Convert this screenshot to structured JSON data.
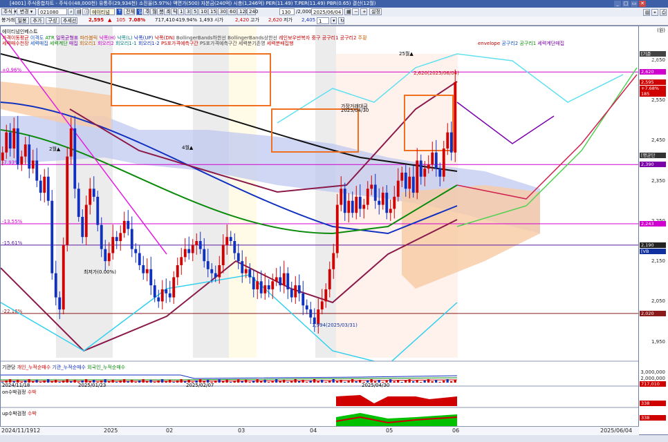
{
  "window": {
    "title": "[4001] 주식종합차트 - 주식수(48,000천) 유통주(29,934천) 소진율(5.97%) 액면가(500) 자본금(240억) 시총(1,246억) PER(11.49) T.PER(11.49) PBR(0.65) 결산(12월)"
  },
  "toolbar": {
    "type_sel": "주식 ▾",
    "change_btn": "변경 ▾",
    "code": "021080",
    "stock_name": "에이티넘",
    "period_label": "T",
    "all_btn": "전체",
    "timeframes": [
      "일",
      "주",
      "월",
      "분",
      "초",
      "틱",
      "1",
      "3",
      "5",
      "10",
      "15",
      "30",
      "60",
      "120",
      "240"
    ],
    "period_arrow": "▾"
  },
  "quote": {
    "company": "에이티넘인베스트",
    "left_tab1": "봉거래",
    "left_tab2": "일봉",
    "tab_add": "추가",
    "tab_comp": "구성",
    "tab_addval": "추세선",
    "price": "2,595",
    "change_arrow": "▲",
    "change": "105",
    "change_pct": "7.08%",
    "volume": "717,410",
    "ratio": "419.94%",
    "ratio_cap": "1,493",
    "open_label": "시가",
    "open": "2,420",
    "high_label": "고가",
    "high": "2,620",
    "low_label": "저가",
    "low": "2,405",
    "count": "130",
    "total": "/2,000",
    "date": "2025/06/04",
    "settings_btn": "설정",
    "page": "1"
  },
  "legend": {
    "row1": [
      "가격이동평균",
      "이격도",
      "ATR",
      "일목균형표",
      "파라볼릭",
      "낙폭(H)",
      "낙폭(L)",
      "낙폭(UP)",
      "낙폭(DN)",
      "BollingerBands하한선",
      "BollingerBands상한선",
      "레인보우반복자",
      "중구",
      "공구리1",
      "공구리2",
      "주황"
    ],
    "row2": [
      "세력매수천장",
      "세력매집",
      "세력계단",
      "매집",
      "회오리1",
      "회오리2",
      "회오리1-1",
      "회오리1-2",
      "PS포가격예측구간",
      "PS포가격예측구간",
      "세력분기존명",
      "세력분배집행"
    ],
    "row3": [
      "envelope",
      "공구리2",
      "공구리1",
      "세력계단매집"
    ]
  },
  "chart_data": {
    "type": "candlestick",
    "title": "에이티넘인베스트 일봉",
    "ylim": [
      1910,
      2720
    ],
    "yticks": [
      2650,
      2550,
      2450,
      2350,
      2250,
      2150,
      2050,
      1950
    ],
    "xlabels": [
      "2024/11/19",
      "12",
      "2025",
      "02",
      "03",
      "04",
      "05",
      "06",
      "2025/06/04"
    ],
    "flags": [
      {
        "label": "[기준선]2,665",
        "value": 2665,
        "color": "#444"
      },
      {
        "label": "2,620",
        "value": 2620,
        "color": "#d000d0"
      },
      {
        "label": "2,595",
        "value": 2595,
        "color": "#d00000"
      },
      {
        "label": "+7.68%",
        "value": 2580,
        "color": "#d00000"
      },
      {
        "label": "185",
        "value": 2565,
        "color": "#d00000"
      },
      {
        "label": "[평균단가]2,412",
        "value": 2412,
        "color": "#333"
      },
      {
        "label": "2,390",
        "value": 2390,
        "color": "#7a00aa"
      },
      {
        "label": "2,243",
        "value": 2243,
        "color": "#d000d0"
      },
      {
        "label": "2,190",
        "value": 2190,
        "color": "#222"
      },
      {
        "label": "[VB선]2,175",
        "value": 2175,
        "color": "#1030a0"
      },
      {
        "label": "2,020",
        "value": 2020,
        "color": "#8a1a1a"
      }
    ],
    "hlines": [
      {
        "label": "+0.96%",
        "value": 2620,
        "color": "#d000d0"
      },
      {
        "label": "-7.93%",
        "value": 2390,
        "color": "#d000d0"
      },
      {
        "label": "-13.55%",
        "value": 2243,
        "color": "#d000d0"
      },
      {
        "label": "-15.61%",
        "value": 2190,
        "color": "#5a1aa0"
      },
      {
        "label": "-22.16%",
        "value": 2020,
        "color": "#8a1a1a"
      }
    ],
    "annotations": [
      {
        "text": "최저가(0.00%)",
        "color": "#000"
      },
      {
        "text": "2월▲",
        "color": "#000"
      },
      {
        "text": "4월▲",
        "color": "#000"
      },
      {
        "text": "25월▲",
        "color": "#000"
      },
      {
        "text": "2,620(2025/06/04)",
        "color": "#d00000"
      },
      {
        "text": "1,994(2025/03/31)",
        "color": "#1030a0"
      },
      {
        "text": "가장거래대금",
        "color": "#000"
      },
      {
        "text": "2025/04/30",
        "color": "#000"
      }
    ],
    "closes": [
      2420,
      2470,
      2430,
      2480,
      2390,
      2410,
      2440,
      2380,
      2400,
      2350,
      2320,
      2360,
      2300,
      2120,
      2060,
      2030,
      2190,
      2410,
      2480,
      2330,
      2260,
      2210,
      2290,
      2330,
      2310,
      2240,
      2180,
      2150,
      2170,
      2210,
      2200,
      2220,
      2250,
      2230,
      2180,
      2170,
      2140,
      2120,
      2130,
      2090,
      2060,
      2050,
      2080,
      2070,
      2060,
      2110,
      2140,
      2160,
      2180,
      2170,
      2190,
      2200,
      2180,
      2150,
      2130,
      2120,
      2110,
      2140,
      2190,
      2210,
      2200,
      2170,
      2150,
      2120,
      2130,
      2110,
      2080,
      2100,
      2070,
      2090,
      2080,
      2100,
      2110,
      2090,
      2120,
      2080,
      2060,
      2090,
      2070,
      2040,
      2030,
      2010,
      1994,
      2030,
      2050,
      2080,
      2130,
      2170,
      2290,
      2330,
      2270,
      2300,
      2270,
      2310,
      2280,
      2290,
      2330,
      2340,
      2300,
      2290,
      2320,
      2270,
      2280,
      2310,
      2350,
      2370,
      2330,
      2360,
      2320,
      2400,
      2360,
      2380,
      2390,
      2420,
      2380,
      2360,
      2430,
      2470,
      2420,
      2595
    ]
  },
  "subpanels": {
    "p1": {
      "labels": [
        "기관당",
        "개인_누적순매수",
        "기관_누적순매수",
        "외국인_누적순매수"
      ],
      "date_l": "2024/11/18",
      "date_m": "2025/01/23",
      "date_r": "2025/02/07",
      "date_r2": "2025/04/30",
      "ticks": [
        "3,000,000",
        "2,000,000"
      ],
      "value": "717,010"
    },
    "p2": {
      "labels": [
        "on수박검정",
        "수박"
      ],
      "tick": "338"
    },
    "p3": {
      "labels": [
        "up수박검정",
        "수박"
      ],
      "tick": "338"
    }
  },
  "statusbar": {
    "text": ""
  }
}
